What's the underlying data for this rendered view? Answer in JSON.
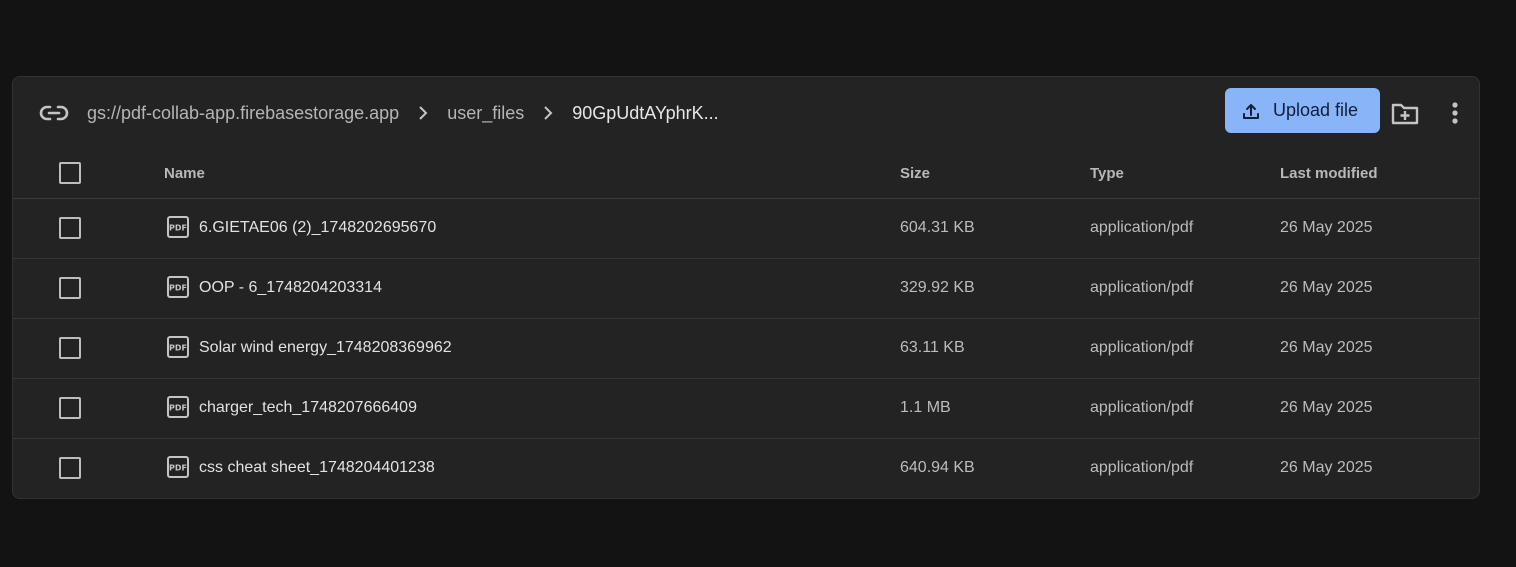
{
  "breadcrumb": {
    "root": "gs://pdf-collab-app.firebasestorage.app",
    "folder": "user_files",
    "current": "90GpUdtAYphrK..."
  },
  "toolbar": {
    "upload_label": "Upload file"
  },
  "table": {
    "headers": {
      "name": "Name",
      "size": "Size",
      "type": "Type",
      "modified": "Last modified"
    },
    "rows": [
      {
        "name": "6.GIETAE06 (2)_1748202695670",
        "size": "604.31 KB",
        "type": "application/pdf",
        "modified": "26 May 2025"
      },
      {
        "name": "OOP - 6_1748204203314",
        "size": "329.92 KB",
        "type": "application/pdf",
        "modified": "26 May 2025"
      },
      {
        "name": "Solar wind energy_1748208369962",
        "size": "63.11 KB",
        "type": "application/pdf",
        "modified": "26 May 2025"
      },
      {
        "name": "charger_tech_1748207666409",
        "size": "1.1 MB",
        "type": "application/pdf",
        "modified": "26 May 2025"
      },
      {
        "name": "css cheat sheet_1748204401238",
        "size": "640.94 KB",
        "type": "application/pdf",
        "modified": "26 May 2025"
      }
    ]
  },
  "icons": {
    "file": "pdf-icon",
    "link": "link-icon",
    "upload": "upload-icon",
    "new_folder": "create-folder-icon",
    "more": "more-vert-icon"
  },
  "colors": {
    "background": "#131313",
    "panel": "#232323",
    "accent": "#8ab4f8"
  }
}
